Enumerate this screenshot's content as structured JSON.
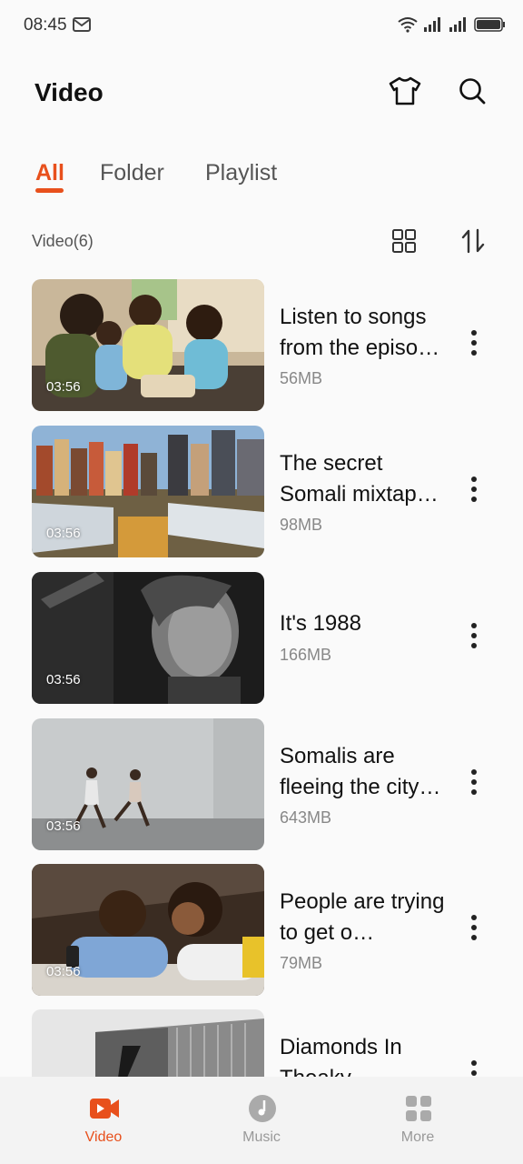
{
  "status_bar": {
    "time": "08:45"
  },
  "header": {
    "title": "Video"
  },
  "tabs": [
    {
      "label": "All",
      "active": true
    },
    {
      "label": "Folder",
      "active": false
    },
    {
      "label": "Playlist",
      "active": false
    }
  ],
  "list": {
    "count_label": "Video(6)"
  },
  "videos": [
    {
      "title": "Listen to songs from the episo…",
      "size": "56MB",
      "duration": "03:56"
    },
    {
      "title": "The secret Somali mixtap…",
      "size": "98MB",
      "duration": "03:56"
    },
    {
      "title": "It's 1988",
      "size": "166MB",
      "duration": "03:56"
    },
    {
      "title": "Somalis are fleeing the city…",
      "size": "643MB",
      "duration": "03:56"
    },
    {
      "title": "People are trying to get o…",
      "size": "79MB",
      "duration": "03:56"
    },
    {
      "title": "Diamonds In Theaky",
      "size": "",
      "duration": ""
    }
  ],
  "bottom_nav": [
    {
      "label": "Video",
      "icon": "video-camera-icon",
      "active": true
    },
    {
      "label": "Music",
      "icon": "music-disc-icon",
      "active": false
    },
    {
      "label": "More",
      "icon": "grid-apps-icon",
      "active": false
    }
  ],
  "colors": {
    "accent": "#e8501c",
    "background": "#fafafa",
    "nav_background": "#f3f3f3",
    "muted_text": "#888888"
  }
}
